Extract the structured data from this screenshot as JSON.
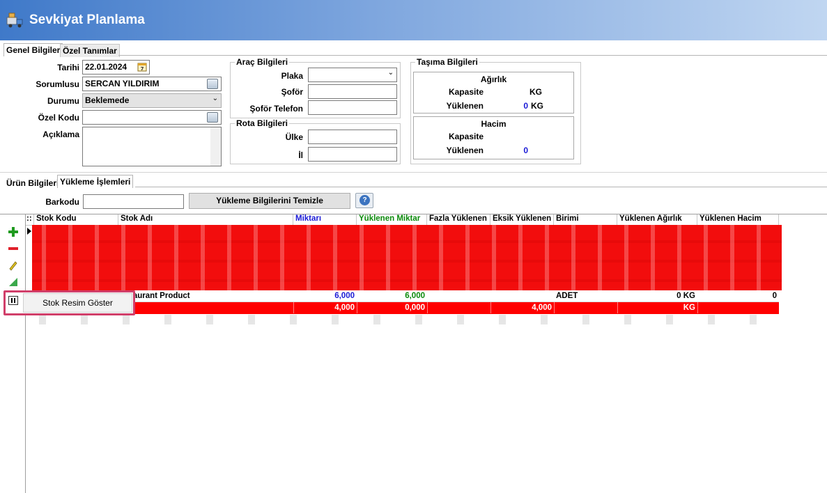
{
  "window": {
    "title": "Sevkiyat Planlama",
    "icon": "truck-icon"
  },
  "top_tabs": [
    {
      "label": "Genel Bilgiler",
      "active": true
    },
    {
      "label": "Özel Tanımlar",
      "active": false
    }
  ],
  "general": {
    "date_label": "Tarihi",
    "date_value": "22.01.2024",
    "responsible_label": "Sorumlusu",
    "responsible_value": "SERCAN YILDIRIM",
    "status_label": "Durumu",
    "status_value": "Beklemede",
    "special_code_label": "Özel Kodu",
    "special_code_value": "",
    "description_label": "Açıklama",
    "description_value": ""
  },
  "vehicle": {
    "title": "Araç Bilgileri",
    "plate_label": "Plaka",
    "plate_value": "",
    "driver_label": "Şoför",
    "driver_value": "",
    "driver_phone_label": "Şoför Telefon",
    "driver_phone_value": ""
  },
  "route": {
    "title": "Rota Bilgileri",
    "country_label": "Ülke",
    "country_value": "",
    "city_label": "İl",
    "city_value": ""
  },
  "transport": {
    "title": "Taşıma Bilgileri",
    "weight": {
      "title": "Ağırlık",
      "capacity_label": "Kapasite",
      "capacity_unit": "KG",
      "loaded_label": "Yüklenen",
      "loaded_value": "0",
      "loaded_unit": "KG"
    },
    "volume": {
      "title": "Hacim",
      "capacity_label": "Kapasite",
      "loaded_label": "Yüklenen",
      "loaded_value": "0"
    }
  },
  "bottom_tabs": [
    {
      "label": "Ürün Bilgileri",
      "active": false
    },
    {
      "label": "Yükleme İşlemleri",
      "active": true
    }
  ],
  "loading": {
    "barcode_label": "Barkodu",
    "barcode_value": "",
    "clear_button": "Yükleme Bilgilerini Temizle",
    "help_icon": "question-icon"
  },
  "grid": {
    "corner": "::",
    "columns": [
      "Stok Kodu",
      "Stok Adı",
      "Miktarı",
      "Yüklenen Miktar",
      "Fazla Yüklenen",
      "Eksik Yüklenen",
      "Birimi",
      "Yüklenen Ağırlık",
      "Yüklenen Hacim"
    ],
    "column_colors": {
      "Miktarı": "#1a1ad6",
      "Yüklenen Miktar": "#0a8a0a"
    },
    "rows": [
      {
        "stock_name": "taurant Product",
        "quantity": "6,000",
        "loaded": "6,000",
        "excess": "",
        "missing": "",
        "unit": "ADET",
        "weight": "0 KG",
        "volume": "0"
      },
      {
        "stock_name": "t",
        "quantity": "4,000",
        "loaded": "0,000",
        "excess": "",
        "missing": "4,000",
        "unit": "",
        "weight": "KG",
        "volume": ""
      }
    ],
    "side_toolbar": [
      "add-icon",
      "remove-icon",
      "edit-icon",
      "excel-icon",
      "image-icon"
    ]
  },
  "context_menu": {
    "item": "Stok Resim Göster"
  },
  "colors": {
    "accent_red": "#ff0000",
    "highlight_border": "#d13f6a",
    "link_blue": "#1a1ad6",
    "green": "#0a8a0a"
  }
}
